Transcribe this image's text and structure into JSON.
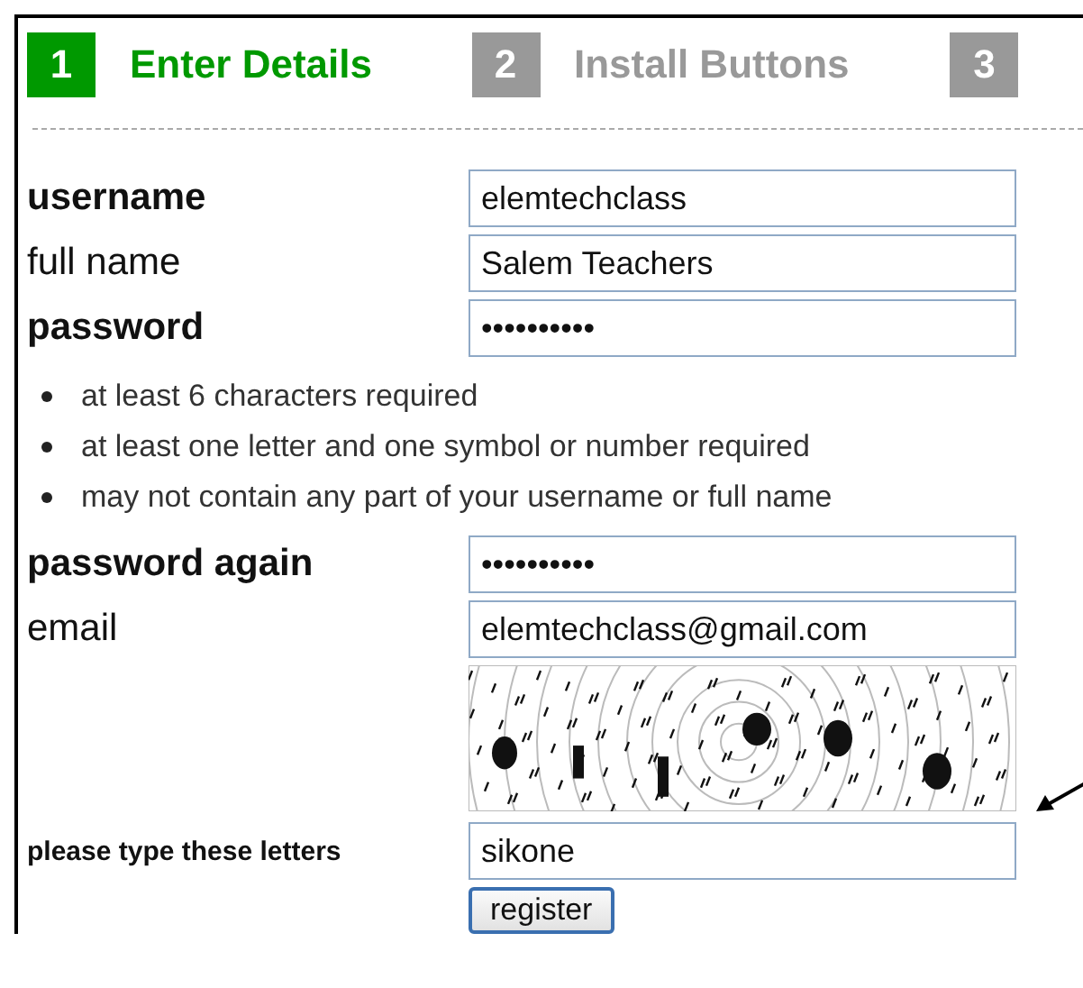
{
  "steps": [
    {
      "number": "1",
      "label": "Enter Details",
      "selected": true
    },
    {
      "number": "2",
      "label": "Install Buttons",
      "selected": false
    },
    {
      "number": "3",
      "selected": false
    }
  ],
  "fields": [
    {
      "label": "username",
      "bold": true,
      "value": "elemtechclass"
    },
    {
      "label": "full name",
      "bold": false,
      "value": "Salem Teachers"
    },
    {
      "label": "password",
      "bold": true,
      "value": "••••••••••"
    }
  ],
  "password_rules": [
    "at least 6 characters required",
    "at least one letter and one symbol or number required",
    "may not contain any part of your username or full name"
  ],
  "fields_after": [
    {
      "label": "password again",
      "bold": true,
      "value": "••••••••••"
    },
    {
      "label": "email",
      "bold": false,
      "value": "elemtechclass@gmail.com"
    }
  ],
  "captcha": {
    "kind": "picture",
    "label": "please type these letters",
    "value": "sikone"
  },
  "register_button": "register"
}
